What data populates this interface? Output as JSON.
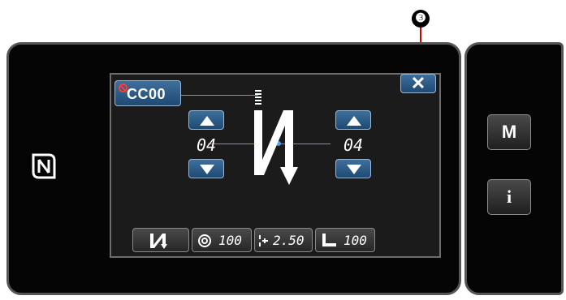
{
  "callout": {
    "label": "❸"
  },
  "screen": {
    "pattern_label": "CC00",
    "close_label": "✕",
    "left_value": "04",
    "right_value": "04",
    "bottom": {
      "speed": "100",
      "pitch": "2.50",
      "presser": "100"
    }
  },
  "side": {
    "m_label": "M",
    "info_label": "i"
  },
  "icons": {
    "nfc": "nfc-icon",
    "stitch": "stitch-pattern-icon",
    "speed": "speed-icon",
    "pitch": "pitch-icon",
    "presser": "presser-foot-icon"
  },
  "colors": {
    "button_blue": "#2f5c87",
    "guide_line": "#4aa0ff",
    "callout_line": "#d40000"
  }
}
